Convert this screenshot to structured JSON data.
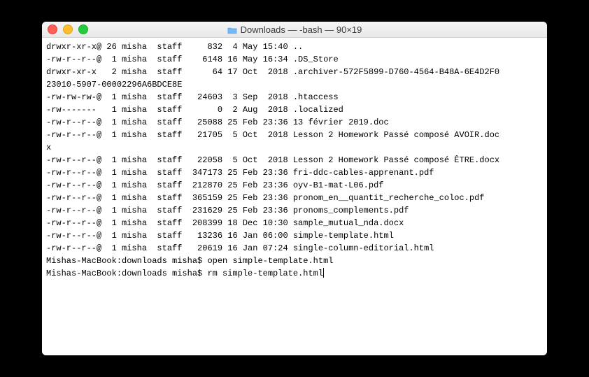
{
  "window": {
    "title": "Downloads — -bash — 90×19"
  },
  "prompt": {
    "host": "Mishas-MacBook",
    "dir": "downloads",
    "user": "misha"
  },
  "listing": [
    {
      "perm": "drwxr-xr-x@",
      "links": "26",
      "user": "misha",
      "group": "staff",
      "size": "832",
      "date": " 4 May 15:40",
      "name": ".."
    },
    {
      "perm": "-rw-r--r--@",
      "links": " 1",
      "user": "misha",
      "group": "staff",
      "size": "6148",
      "date": "16 May 16:34",
      "name": ".DS_Store"
    },
    {
      "perm": "drwxr-xr-x ",
      "links": " 2",
      "user": "misha",
      "group": "staff",
      "size": "64",
      "date": "17 Oct  2018",
      "name": ".archiver-572F5899-D760-4564-B48A-6E4D2F023010-5907-00002296A6BDCE8E"
    },
    {
      "perm": "-rw-rw-rw-@",
      "links": " 1",
      "user": "misha",
      "group": "staff",
      "size": "24603",
      "date": " 3 Sep  2018",
      "name": ".htaccess"
    },
    {
      "perm": "-rw------- ",
      "links": " 1",
      "user": "misha",
      "group": "staff",
      "size": "0",
      "date": " 2 Aug  2018",
      "name": ".localized"
    },
    {
      "perm": "-rw-r--r--@",
      "links": " 1",
      "user": "misha",
      "group": "staff",
      "size": "25088",
      "date": "25 Feb 23:36",
      "name": "13 février 2019.doc"
    },
    {
      "perm": "-rw-r--r--@",
      "links": " 1",
      "user": "misha",
      "group": "staff",
      "size": "21705",
      "date": " 5 Oct  2018",
      "name": "Lesson 2 Homework Passé composé AVOIR.docx"
    },
    {
      "perm": "-rw-r--r--@",
      "links": " 1",
      "user": "misha",
      "group": "staff",
      "size": "22058",
      "date": " 5 Oct  2018",
      "name": "Lesson 2 Homework Passé composé ÊTRE.docx"
    },
    {
      "perm": "-rw-r--r--@",
      "links": " 1",
      "user": "misha",
      "group": "staff",
      "size": "347173",
      "date": "25 Feb 23:36",
      "name": "fri-ddc-cables-apprenant.pdf"
    },
    {
      "perm": "-rw-r--r--@",
      "links": " 1",
      "user": "misha",
      "group": "staff",
      "size": "212870",
      "date": "25 Feb 23:36",
      "name": "oyv-B1-mat-L06.pdf"
    },
    {
      "perm": "-rw-r--r--@",
      "links": " 1",
      "user": "misha",
      "group": "staff",
      "size": "365159",
      "date": "25 Feb 23:36",
      "name": "pronom_en__quantit_recherche_coloc.pdf"
    },
    {
      "perm": "-rw-r--r--@",
      "links": " 1",
      "user": "misha",
      "group": "staff",
      "size": "231629",
      "date": "25 Feb 23:36",
      "name": "pronoms_complements.pdf"
    },
    {
      "perm": "-rw-r--r--@",
      "links": " 1",
      "user": "misha",
      "group": "staff",
      "size": "208399",
      "date": "18 Dec 10:30",
      "name": "sample_mutual_nda.docx"
    },
    {
      "perm": "-rw-r--r--@",
      "links": " 1",
      "user": "misha",
      "group": "staff",
      "size": "13236",
      "date": "16 Jan 06:00",
      "name": "simple-template.html"
    },
    {
      "perm": "-rw-r--r--@",
      "links": " 1",
      "user": "misha",
      "group": "staff",
      "size": "20619",
      "date": "16 Jan 07:24",
      "name": "single-column-editorial.html"
    }
  ],
  "history": [
    {
      "cmd": "open simple-template.html"
    }
  ],
  "current_cmd": "rm simple-template.html",
  "columns": 90
}
